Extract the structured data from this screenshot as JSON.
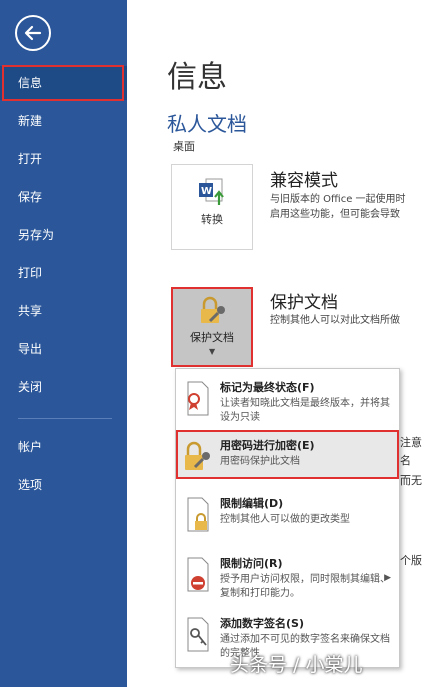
{
  "sidebar": {
    "items": [
      {
        "label": "信息"
      },
      {
        "label": "新建"
      },
      {
        "label": "打开"
      },
      {
        "label": "保存"
      },
      {
        "label": "另存为"
      },
      {
        "label": "打印"
      },
      {
        "label": "共享"
      },
      {
        "label": "导出"
      },
      {
        "label": "关闭"
      },
      {
        "label": "帐户"
      },
      {
        "label": "选项"
      }
    ]
  },
  "main": {
    "title": "信息",
    "doc_name": "私人文档",
    "doc_path": "桌面",
    "compat": {
      "tile_label": "转换",
      "title": "兼容模式",
      "desc_line1": "与旧版本的 Office 一起使用时",
      "desc_line2": "启用这些功能，但可能会导致"
    },
    "protect": {
      "tile_label": "保护文档",
      "title": "保护文档",
      "desc": "控制其他人可以对此文档所做"
    },
    "menu": {
      "items": [
        {
          "title": "标记为最终状态(F)",
          "desc": "让读者知晓此文档是最终版本，并将其设为只读"
        },
        {
          "title": "用密码进行加密(E)",
          "desc": "用密码保护此文档"
        },
        {
          "title": "限制编辑(D)",
          "desc": "控制其他人可以做的更改类型"
        },
        {
          "title": "限制访问(R)",
          "desc": "授予用户访问权限，同时限制其编辑、复制和打印能力。"
        },
        {
          "title": "添加数字签名(S)",
          "desc": "通过添加不可见的数字签名来确保文档的完整性"
        }
      ]
    },
    "right_clips": [
      "注意",
      "名",
      "而无",
      "个版"
    ]
  },
  "watermark": "头条号 / 小棠儿",
  "colors": {
    "sidebar": "#2b579a",
    "accent": "#2b579a",
    "highlight_border": "#e03030"
  }
}
